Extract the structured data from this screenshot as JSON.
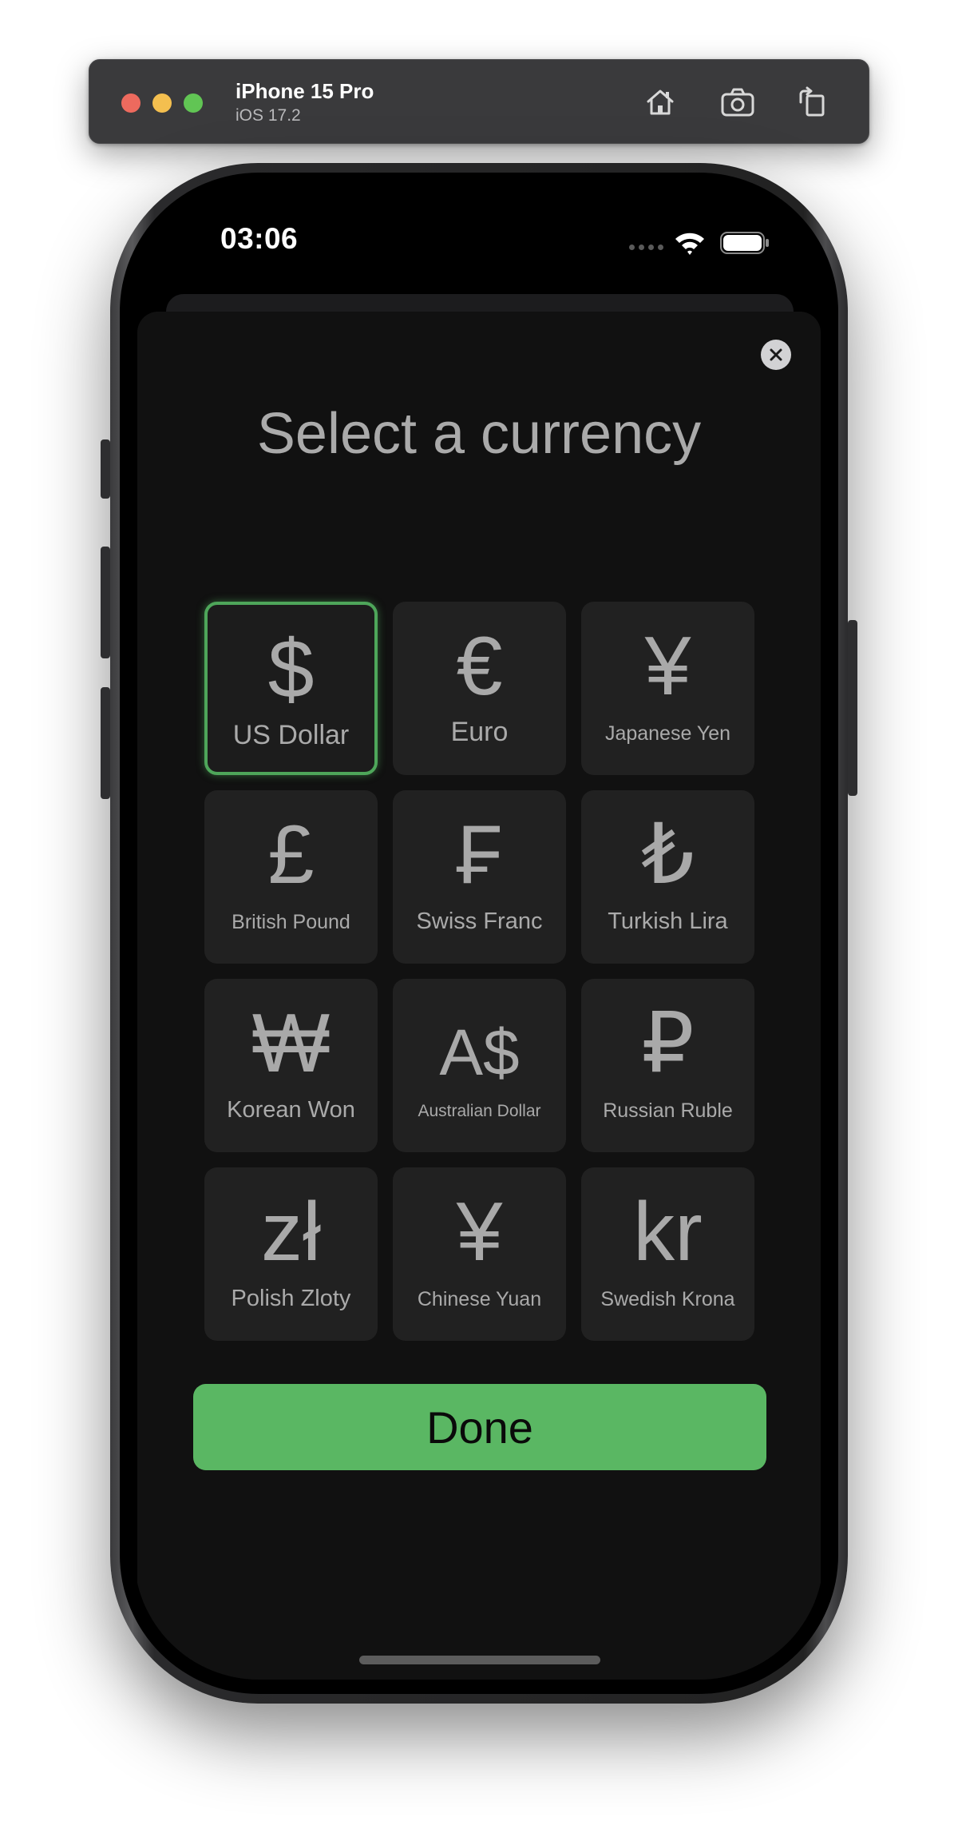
{
  "simulator": {
    "device_name": "iPhone 15 Pro",
    "os_version": "iOS 17.2",
    "home_icon": "home-icon",
    "screenshot_icon": "camera-icon",
    "rotate_icon": "rotate-icon"
  },
  "status_bar": {
    "time": "03:06",
    "wifi_icon": "wifi-icon",
    "battery_icon": "battery-icon"
  },
  "sheet": {
    "title": "Select a currency",
    "close_icon": "close-icon",
    "done_label": "Done"
  },
  "currencies": [
    {
      "symbol": "$",
      "name": "US Dollar",
      "selected": true
    },
    {
      "symbol": "€",
      "name": "Euro",
      "selected": false
    },
    {
      "symbol": "¥",
      "name": "Japanese Yen",
      "selected": false
    },
    {
      "symbol": "£",
      "name": "British Pound",
      "selected": false
    },
    {
      "symbol": "₣",
      "name": "Swiss Franc",
      "selected": false
    },
    {
      "symbol": "₺",
      "name": "Turkish Lira",
      "selected": false
    },
    {
      "symbol": "₩",
      "name": "Korean Won",
      "selected": false
    },
    {
      "symbol": "A$",
      "name": "Australian Dollar",
      "selected": false
    },
    {
      "symbol": "₽",
      "name": "Russian Ruble",
      "selected": false
    },
    {
      "symbol": "zł",
      "name": "Polish Zloty",
      "selected": false
    },
    {
      "symbol": "¥",
      "name": "Chinese Yuan",
      "selected": false
    },
    {
      "symbol": "kr",
      "name": "Swedish Krona",
      "selected": false
    }
  ],
  "colors": {
    "accent_green": "#5ab763",
    "selected_border": "#4ea65a",
    "tile_bg": "#212121",
    "sheet_bg": "#111111"
  }
}
